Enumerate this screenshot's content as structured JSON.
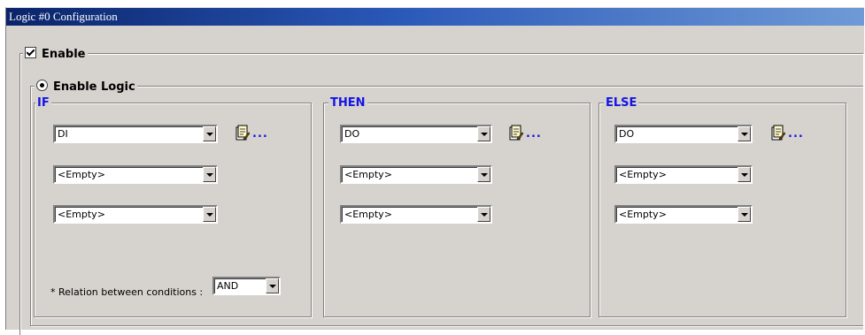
{
  "window": {
    "title": "Logic #0 Configuration"
  },
  "enable": {
    "label": "Enable",
    "checked": true
  },
  "enable_logic": {
    "label": "Enable Logic",
    "selected": true
  },
  "if_group": {
    "label": "IF",
    "combos": [
      "DI",
      "<Empty>",
      "<Empty>"
    ],
    "relation_label": "* Relation between conditions :",
    "relation_value": "AND"
  },
  "then_group": {
    "label": "THEN",
    "combos": [
      "DO",
      "<Empty>",
      "<Empty>"
    ]
  },
  "else_group": {
    "label": "ELSE",
    "combos": [
      "DO",
      "<Empty>",
      "<Empty>"
    ]
  },
  "icons": {
    "edit": "edit-document-icon",
    "more_text": "..."
  },
  "colors": {
    "title_start": "#0a246a",
    "title_end": "#6e9ad6",
    "group_label": "#1414e6",
    "face": "#d6d3ce"
  }
}
